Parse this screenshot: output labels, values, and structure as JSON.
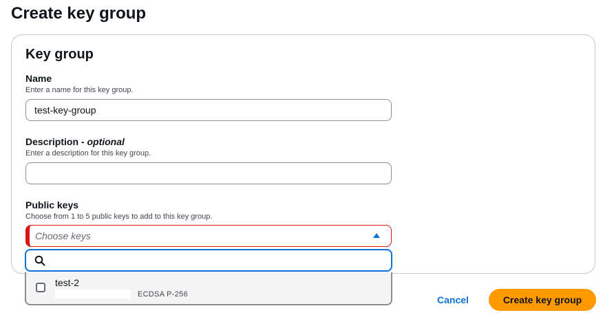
{
  "page": {
    "title": "Create key group"
  },
  "card": {
    "title": "Key group",
    "name": {
      "label": "Name",
      "description": "Enter a name for this key group.",
      "value": "test-key-group"
    },
    "description": {
      "label": "Description - ",
      "label_optional": "optional",
      "description": "Enter a description for this key group.",
      "value": ""
    },
    "public_keys": {
      "label": "Public keys",
      "description": "Choose from 1 to 5 public keys to add to this key group.",
      "placeholder": "Choose keys",
      "state": "error",
      "dropdown_open": true,
      "search_value": "",
      "options": [
        {
          "name": "test-2",
          "tag": "ECDSA P-256",
          "checked": false
        }
      ]
    }
  },
  "footer": {
    "cancel_label": "Cancel",
    "submit_label": "Create key group"
  },
  "colors": {
    "accent": "#0972d3",
    "error": "#d91515",
    "primary_button": "#ff9900"
  },
  "icons": {
    "search": "search-icon",
    "caret": "caret-up-icon"
  }
}
